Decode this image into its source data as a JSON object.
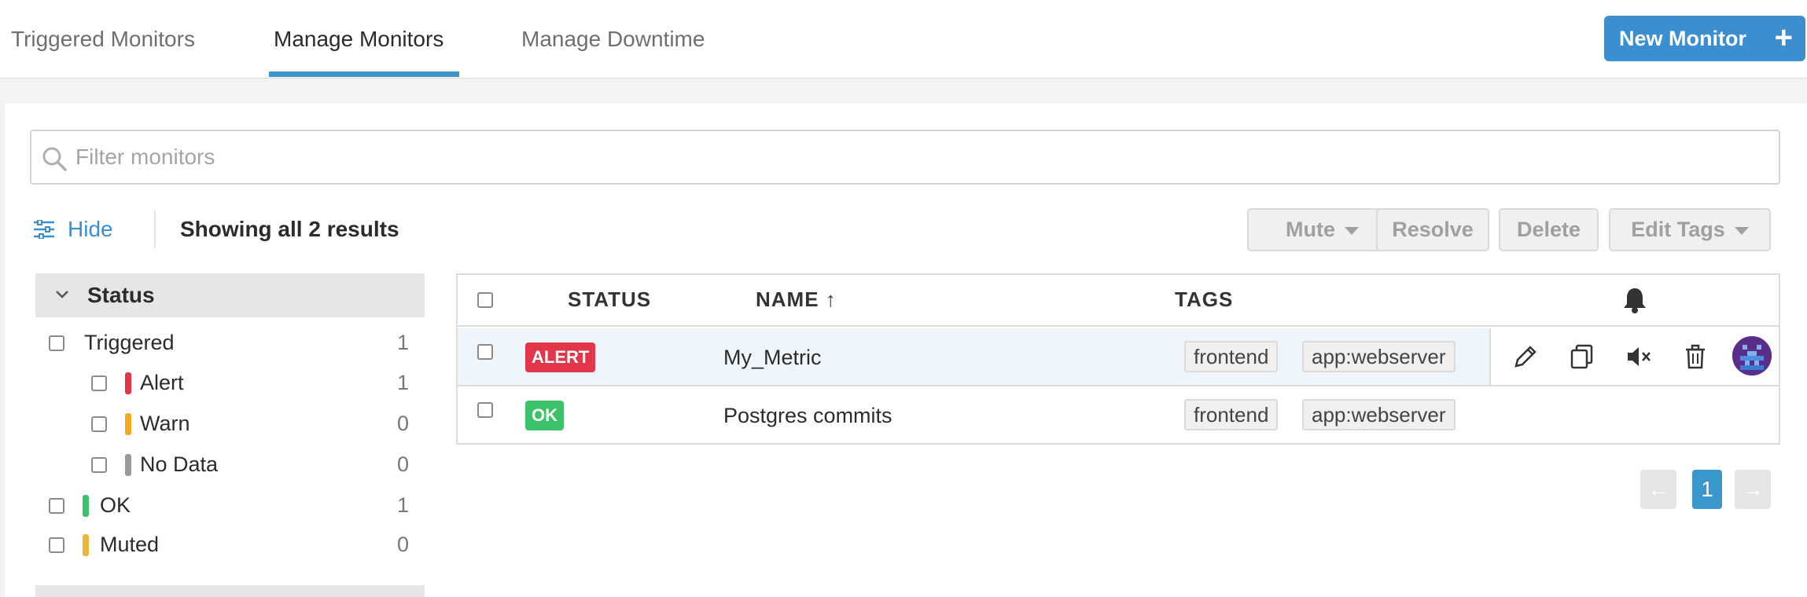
{
  "tabs": [
    {
      "label": "Triggered Monitors",
      "active": false
    },
    {
      "label": "Manage Monitors",
      "active": true
    },
    {
      "label": "Manage Downtime",
      "active": false
    }
  ],
  "new_monitor": {
    "label": "New Monitor",
    "icon": "plus-icon"
  },
  "search": {
    "placeholder": "Filter monitors",
    "value": ""
  },
  "toolbar": {
    "hide_label": "Hide",
    "results_text": "Showing all 2 results",
    "mute_label": "Mute",
    "resolve_label": "Resolve",
    "delete_label": "Delete",
    "edit_tags_label": "Edit Tags"
  },
  "sidebar": {
    "facet_title": "Status",
    "items": [
      {
        "label": "Triggered",
        "count": "1",
        "color": "",
        "indent": 0
      },
      {
        "label": "Alert",
        "count": "1",
        "color": "#e2364a",
        "indent": 1
      },
      {
        "label": "Warn",
        "count": "0",
        "color": "#f5a623",
        "indent": 1
      },
      {
        "label": "No Data",
        "count": "0",
        "color": "#9a9a9a",
        "indent": 1
      },
      {
        "label": "OK",
        "count": "1",
        "color": "#3cc36a",
        "indent": 0
      },
      {
        "label": "Muted",
        "count": "0",
        "color": "#f0b33a",
        "indent": 0
      }
    ]
  },
  "table": {
    "headers": {
      "status": "STATUS",
      "name": "NAME ↑",
      "tags": "TAGS",
      "notify_icon": "bell-icon"
    },
    "rows": [
      {
        "status": "ALERT",
        "status_color": "#e2364a",
        "name": "My_Metric",
        "tags": [
          "frontend",
          "app:webserver"
        ]
      },
      {
        "status": "OK",
        "status_color": "#3cc36a",
        "name": "Postgres commits",
        "tags": [
          "frontend",
          "app:webserver"
        ]
      }
    ],
    "row_actions": [
      "edit-icon",
      "clone-icon",
      "mute-icon",
      "delete-icon",
      "avatar"
    ]
  },
  "pagination": {
    "prev": "←",
    "current": "1",
    "next": "→"
  },
  "colors": {
    "accent": "#3b8fd0",
    "alert": "#e2364a",
    "ok": "#3cc36a",
    "warn": "#f5a623"
  }
}
